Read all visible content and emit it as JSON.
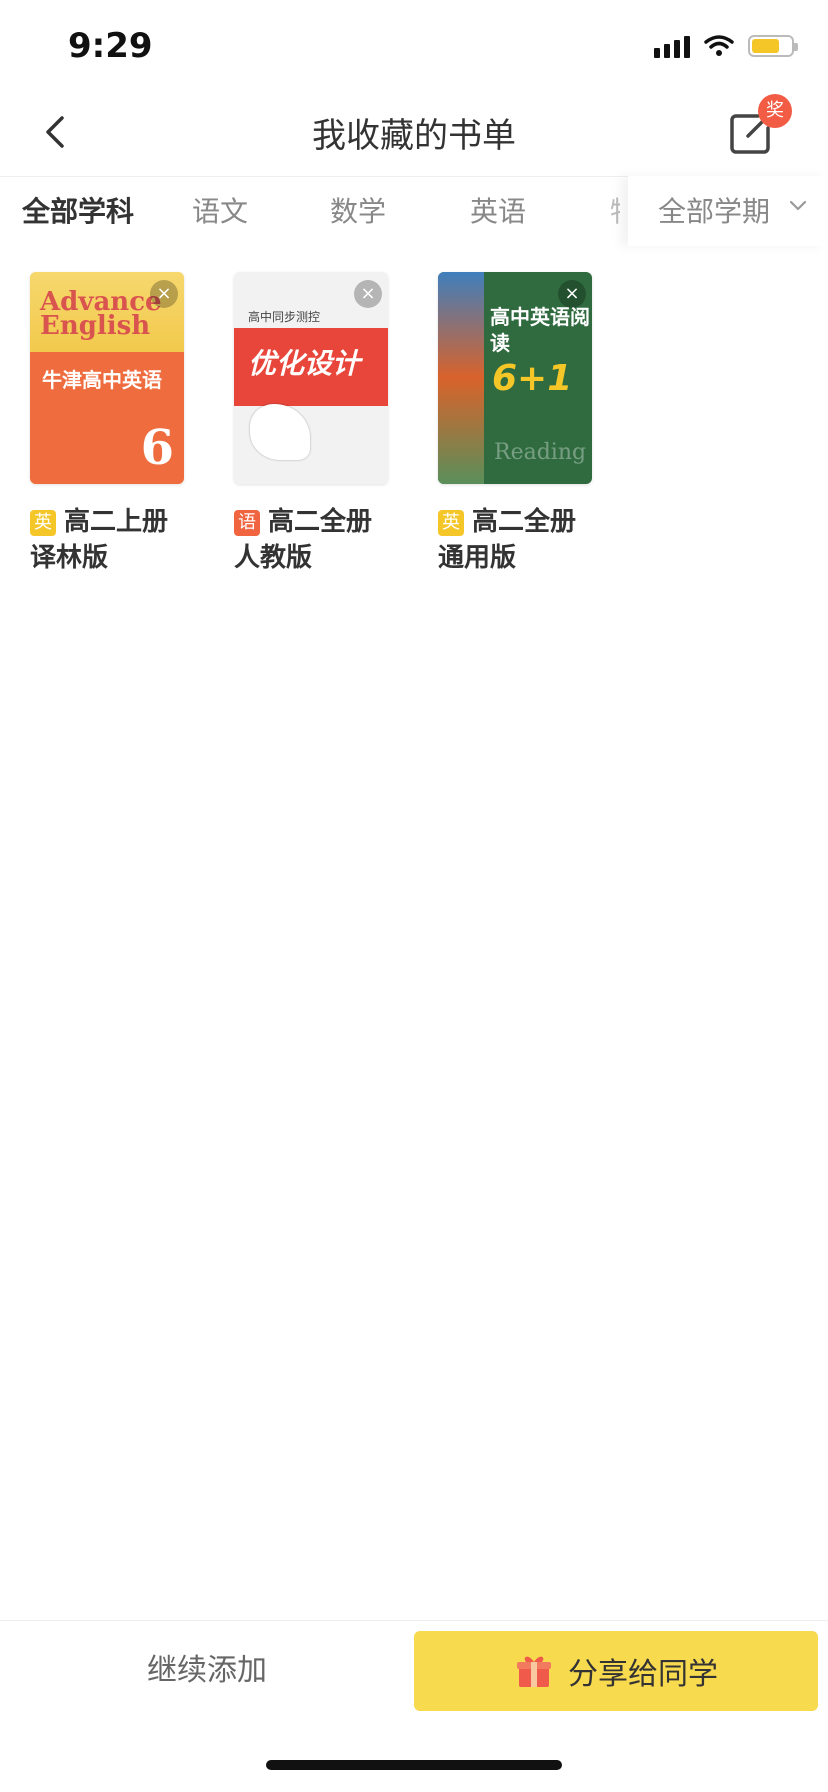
{
  "status_bar": {
    "time": "9:29",
    "battery_level": 0.7
  },
  "header": {
    "title": "我收藏的书单",
    "badge": "奖"
  },
  "tabs": [
    {
      "label": "全部学科"
    },
    {
      "label": "语文"
    },
    {
      "label": "数学"
    },
    {
      "label": "英语"
    }
  ],
  "term_filter": {
    "label": "全部学期"
  },
  "books": [
    {
      "subject": "英",
      "subject_color": "#f5c628",
      "line1": "高二上册",
      "line2": "译林版",
      "cover": {
        "en_title": "Advance English",
        "cn_title": "牛津高中英语",
        "number": "6"
      }
    },
    {
      "subject": "语",
      "subject_color": "#f0643f",
      "line1": "高二全册",
      "line2": "人教版",
      "cover": {
        "small": "高中同步测控",
        "title": "优化设计"
      }
    },
    {
      "subject": "英",
      "subject_color": "#f5c628",
      "line1": "高二全册",
      "line2": "通用版",
      "cover": {
        "title": "高中英语阅读",
        "num": "6+1",
        "word": "Reading"
      }
    }
  ],
  "bottom": {
    "continue": "继续添加",
    "share": "分享给同学"
  },
  "colors": {
    "accent": "#f8da4f",
    "badge": "#f25c45"
  }
}
